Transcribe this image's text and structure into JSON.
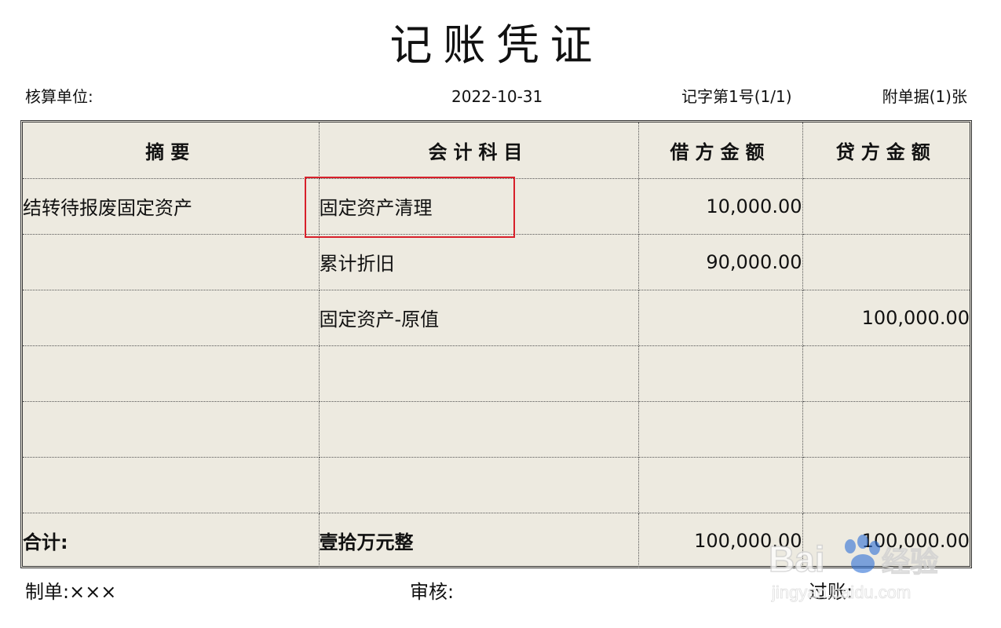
{
  "title": "记账凭证",
  "meta": {
    "unit_label": "核算单位:",
    "date": "2022-10-31",
    "voucher_no": "记字第1号(1/1)",
    "attachments": "附单据(1)张"
  },
  "table": {
    "headers": [
      "摘要",
      "会计科目",
      "借方金额",
      "贷方金额"
    ],
    "rows": [
      {
        "summary": "结转待报废固定资产",
        "account": "固定资产清理",
        "debit": "10,000.00",
        "credit": ""
      },
      {
        "summary": "",
        "account": "累计折旧",
        "debit": "90,000.00",
        "credit": ""
      },
      {
        "summary": "",
        "account": "固定资产-原值",
        "debit": "",
        "credit": "100,000.00"
      },
      {
        "summary": "",
        "account": "",
        "debit": "",
        "credit": ""
      },
      {
        "summary": "",
        "account": "",
        "debit": "",
        "credit": ""
      },
      {
        "summary": "",
        "account": "",
        "debit": "",
        "credit": ""
      }
    ],
    "total": {
      "label": "合计:",
      "amount_in_words": "壹拾万元整",
      "debit": "100,000.00",
      "credit": "100,000.00"
    }
  },
  "signatures": {
    "maker": "制单:×××",
    "reviewer": "审核:",
    "poster": "过账:"
  },
  "watermark": {
    "brand": "Bai",
    "brand_cn": "经验",
    "url": "jingyan.baidu.com"
  },
  "colors": {
    "table_background": "#edeae0",
    "highlight": "#d8202a",
    "paw_blue": "#2d6fd6"
  }
}
